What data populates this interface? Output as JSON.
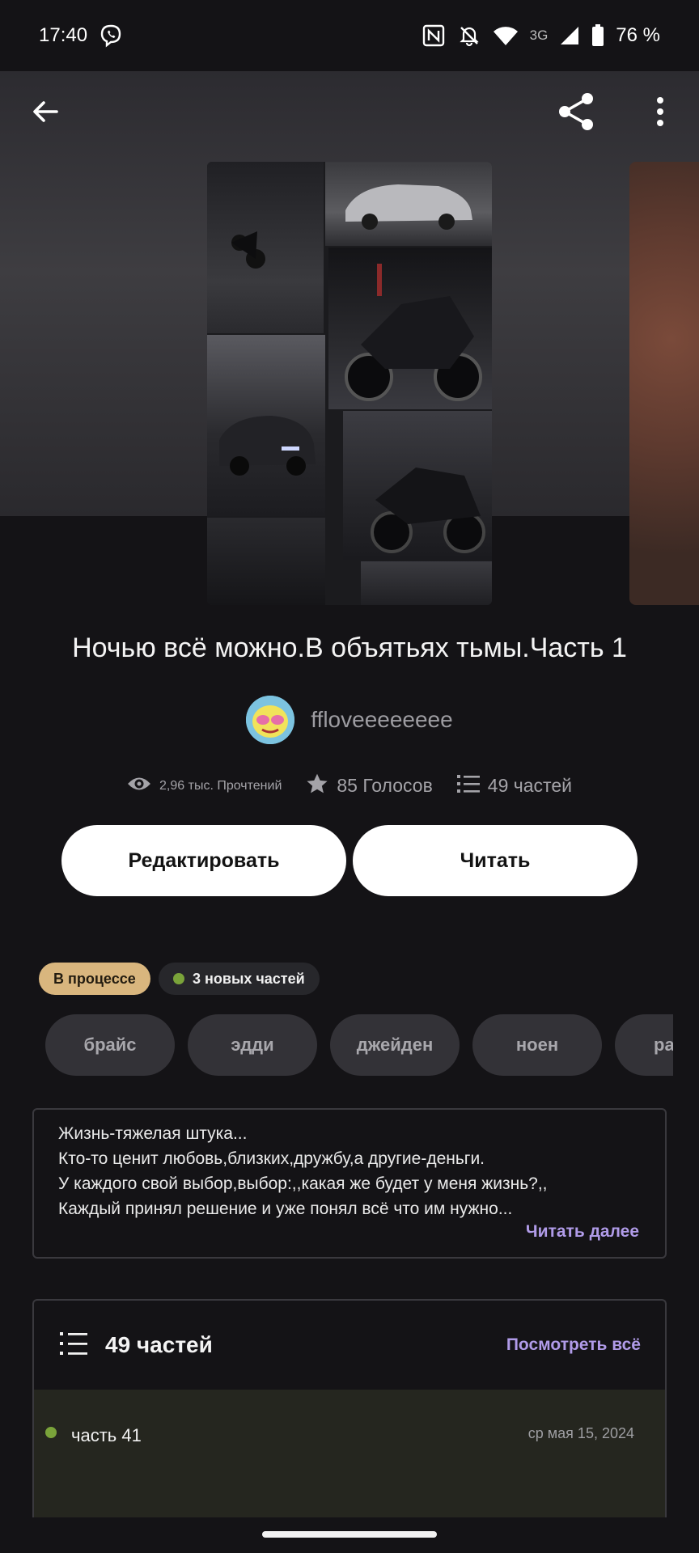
{
  "status_bar": {
    "time": "17:40",
    "network": "3G",
    "battery": "76 %"
  },
  "book": {
    "title": "Ночью всё можно.В объятьях тьмы.Часть 1",
    "author": "ffloveeeeeeee",
    "reads": "2,96 тыс. Прочтений",
    "votes": "85 Голосов",
    "parts_count": "49 частей"
  },
  "actions": {
    "edit_label": "Редактировать",
    "read_label": "Читать"
  },
  "badges": {
    "status": "В процессе",
    "new_parts": "3 новых частей"
  },
  "tags": [
    "брайс",
    "эдди",
    "джейден",
    "ноен",
    "ра"
  ],
  "description": {
    "lines": [
      "Жизнь-тяжелая штука...",
      "Кто-то ценит любовь,близких,дружбу,а другие-деньги.",
      "У каждого свой выбор,выбор:,,какая же будет у меня жизнь?,,",
      "Каждый принял решение и уже понял всё что им нужно..."
    ],
    "read_more": "Читать далее"
  },
  "parts_section": {
    "title": "49 частей",
    "view_all": "Посмотреть всё",
    "items": [
      {
        "name": "часть 41",
        "date": "ср мая 15, 2024"
      }
    ]
  },
  "colors": {
    "background": "#141316",
    "accent": "#b09be8",
    "status_badge": "#d9b67e",
    "new_dot": "#7aa33a"
  },
  "icons": {
    "back": "arrow-left-icon",
    "share": "share-icon",
    "more": "more-vertical-icon",
    "reads": "eye-icon",
    "votes": "star-icon",
    "parts": "list-icon"
  }
}
